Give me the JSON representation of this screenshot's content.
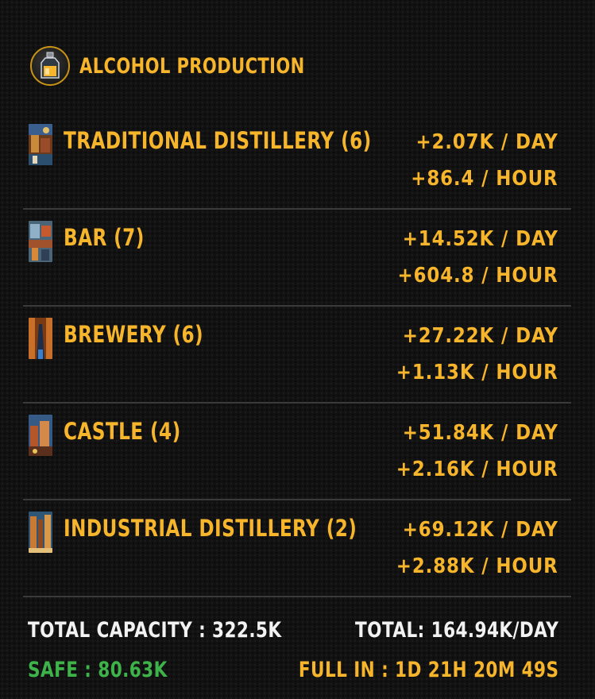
{
  "header": {
    "title": "ALCOHOL PRODUCTION",
    "icon": "bottle-icon"
  },
  "buildings": [
    {
      "name": "TRADITIONAL DISTILLERY (6)",
      "per_day": "+2.07K / DAY",
      "per_hour": "+86.4 / HOUR",
      "icon": "traditional-distillery-thumbnail"
    },
    {
      "name": "BAR (7)",
      "per_day": "+14.52K / DAY",
      "per_hour": "+604.8 / HOUR",
      "icon": "bar-thumbnail"
    },
    {
      "name": "BREWERY (6)",
      "per_day": "+27.22K / DAY",
      "per_hour": "+1.13K / HOUR",
      "icon": "brewery-thumbnail"
    },
    {
      "name": "CASTLE (4)",
      "per_day": "+51.84K / DAY",
      "per_hour": "+2.16K / HOUR",
      "icon": "castle-thumbnail"
    },
    {
      "name": "INDUSTRIAL DISTILLERY (2)",
      "per_day": "+69.12K / DAY",
      "per_hour": "+2.88K / HOUR",
      "icon": "industrial-distillery-thumbnail"
    }
  ],
  "footer": {
    "total_capacity": "TOTAL CAPACITY : 322.5K",
    "total": "TOTAL: 164.94K/DAY",
    "safe": "SAFE : 80.63K",
    "full_in": "FULL IN : 1D 21H 20M 49S"
  },
  "colors": {
    "accent": "#f7b52b",
    "safe": "#3eb34a",
    "text_light": "#f2f2f2",
    "background": "#121212",
    "divider": "#3a3a3a"
  }
}
